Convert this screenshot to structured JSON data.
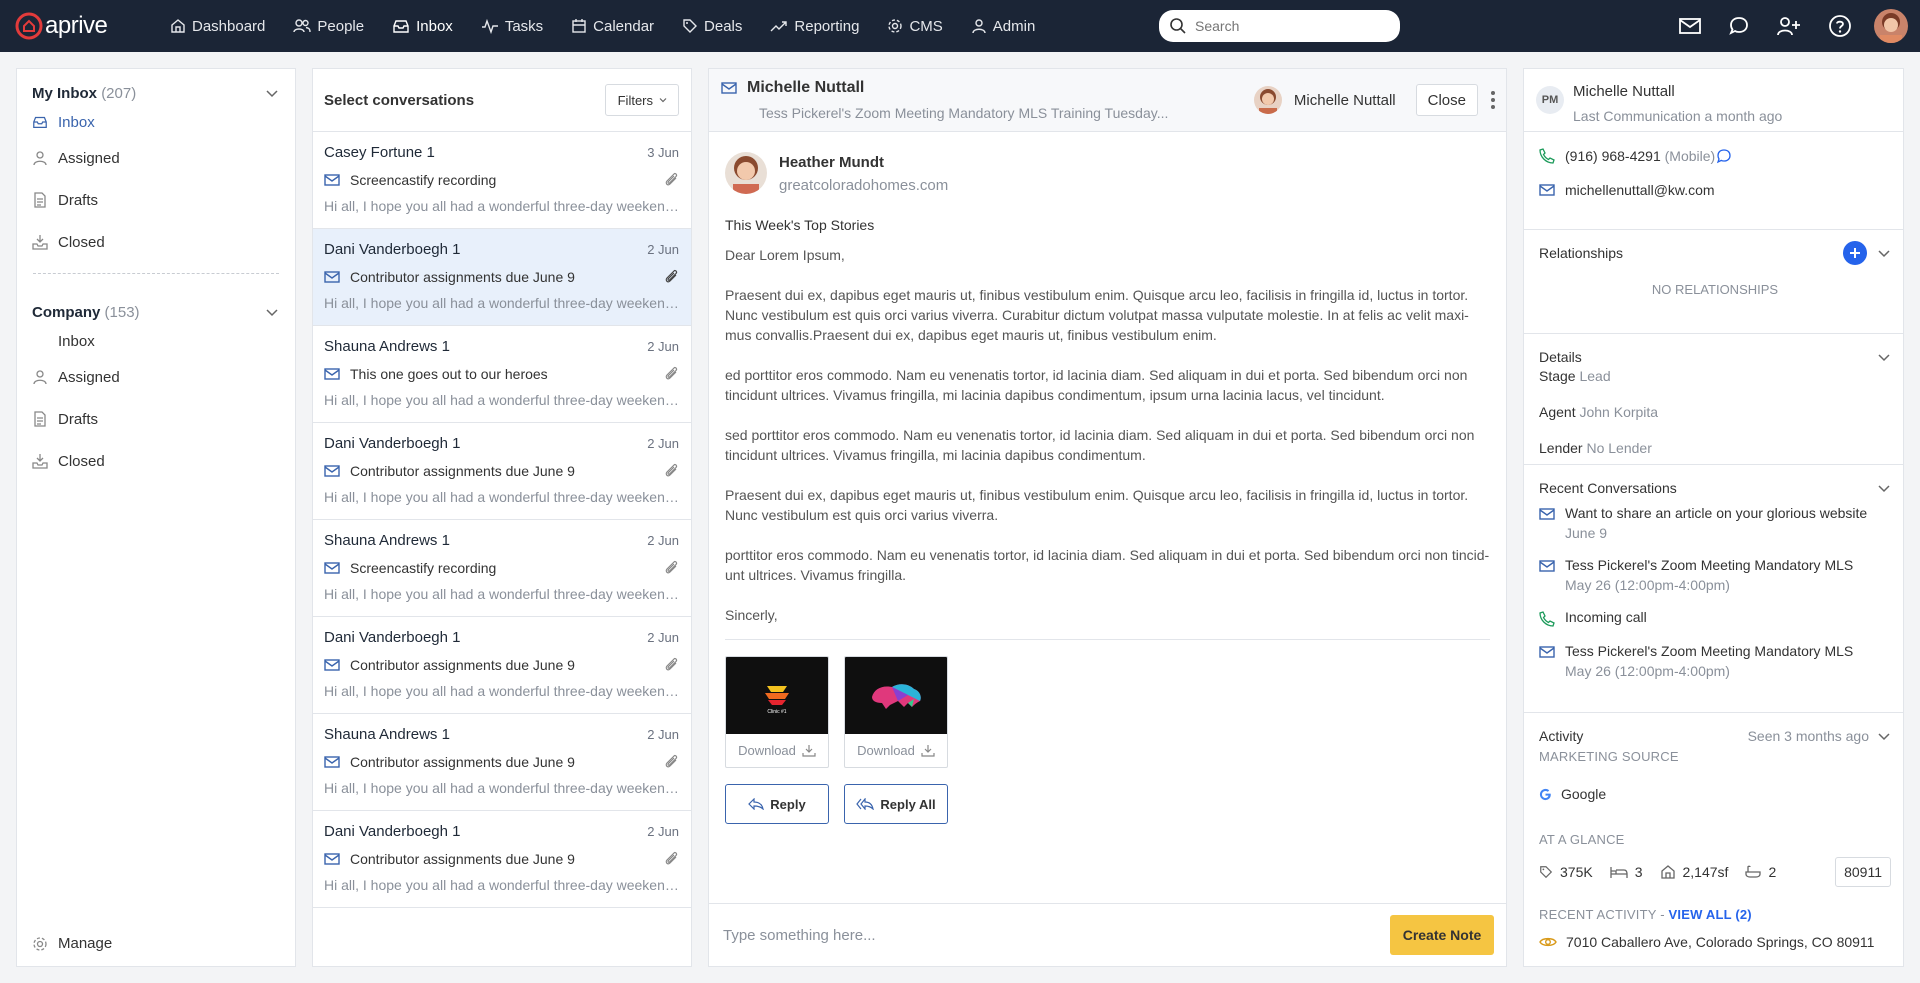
{
  "nav": {
    "logo": "aprive",
    "items": [
      {
        "label": "Dashboard",
        "icon": "home-icon"
      },
      {
        "label": "People",
        "icon": "people-icon"
      },
      {
        "label": "Inbox",
        "icon": "inbox-icon"
      },
      {
        "label": "Tasks",
        "icon": "tasks-icon"
      },
      {
        "label": "Calendar",
        "icon": "calendar-icon"
      },
      {
        "label": "Deals",
        "icon": "tag-icon"
      },
      {
        "label": "Reporting",
        "icon": "trend-icon"
      },
      {
        "label": "CMS",
        "icon": "gear-icon"
      },
      {
        "label": "Admin",
        "icon": "user-icon"
      }
    ],
    "search_placeholder": "Search"
  },
  "sidebar": {
    "my_inbox": {
      "title": "My Inbox",
      "count": "(207)",
      "items": [
        "Inbox",
        "Assigned",
        "Drafts",
        "Closed"
      ]
    },
    "company": {
      "title": "Company",
      "count": "(153)",
      "items": [
        "Inbox",
        "Assigned",
        "Drafts",
        "Closed"
      ]
    },
    "manage": "Manage"
  },
  "conversations": {
    "title": "Select conversations",
    "filters": "Filters",
    "items": [
      {
        "name": "Casey Fortune 1",
        "date": "3 Jun",
        "subject": "Screencastify recording",
        "preview": "Hi all, I hope you all had a wonderful three-day weekend..."
      },
      {
        "name": "Dani Vanderboegh 1",
        "date": "2 Jun",
        "subject": "Contributor assignments due June 9",
        "preview": "Hi all, I hope you all had a wonderful three-day weekend..."
      },
      {
        "name": "Shauna Andrews 1",
        "date": "2 Jun",
        "subject": "This one goes out to our heroes",
        "preview": "Hi all, I hope you all had a wonderful three-day weekend..."
      },
      {
        "name": "Dani Vanderboegh 1",
        "date": "2 Jun",
        "subject": "Contributor assignments due June 9",
        "preview": "Hi all, I hope you all had a wonderful three-day weekend..."
      },
      {
        "name": "Shauna Andrews 1",
        "date": "2 Jun",
        "subject": "Screencastify recording",
        "preview": "Hi all, I hope you all had a wonderful three-day weekend..."
      },
      {
        "name": "Dani Vanderboegh 1",
        "date": "2 Jun",
        "subject": "Contributor assignments due June 9",
        "preview": "Hi all, I hope you all had a wonderful three-day weekend..."
      },
      {
        "name": "Shauna Andrews 1",
        "date": "2 Jun",
        "subject": "Contributor assignments due June 9",
        "preview": "Hi all, I hope you all had a wonderful three-day weekend..."
      },
      {
        "name": "Dani Vanderboegh 1",
        "date": "2 Jun",
        "subject": "Contributor assignments due June 9",
        "preview": "Hi all, I hope you all had a wonderful three-day weekend..."
      }
    ]
  },
  "message": {
    "contact": "Michelle Nuttall",
    "subject": "Tess Pickerel's Zoom Meeting Mandatory MLS Training Tuesday...",
    "assignee": "Michelle Nuttall",
    "close": "Close",
    "sender_name": "Heather Mundt",
    "sender_email": "greatcoloradohomes.com",
    "headline": "This Week's Top Stories",
    "greeting": "Dear Lorem Ipsum,",
    "paragraphs": [
      "Praesent dui ex, dapibus eget mauris ut, finibus vestibulum enim. Quisque arcu leo, facilisis in fringilla id, luctus in tortor. Nunc vestibulum est quis orci varius viverra. Curabitur dictum volutpat massa vulputate molestie. In at felis ac velit maxi- mus convallis.Praesent dui ex, dapibus eget mauris ut, finibus vestibulum enim.",
      "ed porttitor eros commodo. Nam eu venenatis tortor, id lacinia diam. Sed aliquam in dui et porta. Sed bibendum orci non tincidunt ultrices. Vivamus fringilla, mi lacinia dapibus condimentum, ipsum urna lacinia lacus, vel tincidunt.",
      "sed porttitor eros commodo. Nam eu venenatis tortor, id lacinia diam. Sed aliquam in dui et porta. Sed bibendum orci non tincidunt ultrices. Vivamus fringilla, mi lacinia dapibus condimentum.",
      "Praesent dui ex, dapibus eget mauris ut, finibus vestibulum enim. Quisque arcu leo, facilisis in fringilla id, luctus in tortor. Nunc vestibulum est quis orci varius viverra.",
      "porttitor eros commodo. Nam eu venenatis tortor, id lacinia diam. Sed aliquam in dui et porta. Sed bibendum orci non tincid- unt ultrices. Vivamus fringilla."
    ],
    "signoff": "Sincerly,",
    "attachments": [
      {
        "label": "Download",
        "caption": "Clinic #1"
      },
      {
        "label": "Download"
      }
    ],
    "reply": "Reply",
    "reply_all": "Reply All",
    "note_placeholder": "Type something here...",
    "create_note": "Create Note"
  },
  "contact": {
    "initials": "PM",
    "name": "Michelle Nuttall",
    "last_comm": "Last Communication a month ago",
    "phone": "(916) 968-4291",
    "phone_type": "(Mobile)",
    "email": "michellenuttall@kw.com",
    "relationships_title": "Relationships",
    "no_relationships": "NO RELATIONSHIPS",
    "details_title": "Details",
    "stage_label": "Stage",
    "stage": "Lead",
    "agent_label": "Agent",
    "agent": "John Korpita",
    "lender_label": "Lender",
    "lender": "No Lender",
    "recent_title": "Recent Conversations",
    "recent": [
      {
        "title": "Want to share an article on your glorious website",
        "sub": "June 9"
      },
      {
        "title": "Tess Pickerel's Zoom Meeting Mandatory MLS",
        "sub": "May 26 (12:00pm-4:00pm)"
      },
      {
        "title": "Incoming call",
        "sub": ""
      },
      {
        "title": "Tess Pickerel's Zoom Meeting Mandatory MLS",
        "sub": "May 26 (12:00pm-4:00pm)"
      }
    ],
    "activity_title": "Activity",
    "seen": "Seen 3 months ago",
    "marketing_source_label": "MARKETING SOURCE",
    "marketing_source": "Google",
    "glance_label": "AT A GLANCE",
    "price": "375K",
    "beds": "3",
    "sqft": "2,147sf",
    "baths": "2",
    "zip": "80911",
    "recent_activity_label": "RECENT ACTIVITY - ",
    "view_all": "VIEW ALL (2)",
    "address": "7010 Caballero Ave, Colorado Springs, CO 80911"
  },
  "colors": {
    "nav_bg": "#1b2536",
    "accent": "#2563eb",
    "selected_row": "#e8f0fb",
    "create_note": "#f5c542",
    "logo_red": "#e23b3b"
  }
}
